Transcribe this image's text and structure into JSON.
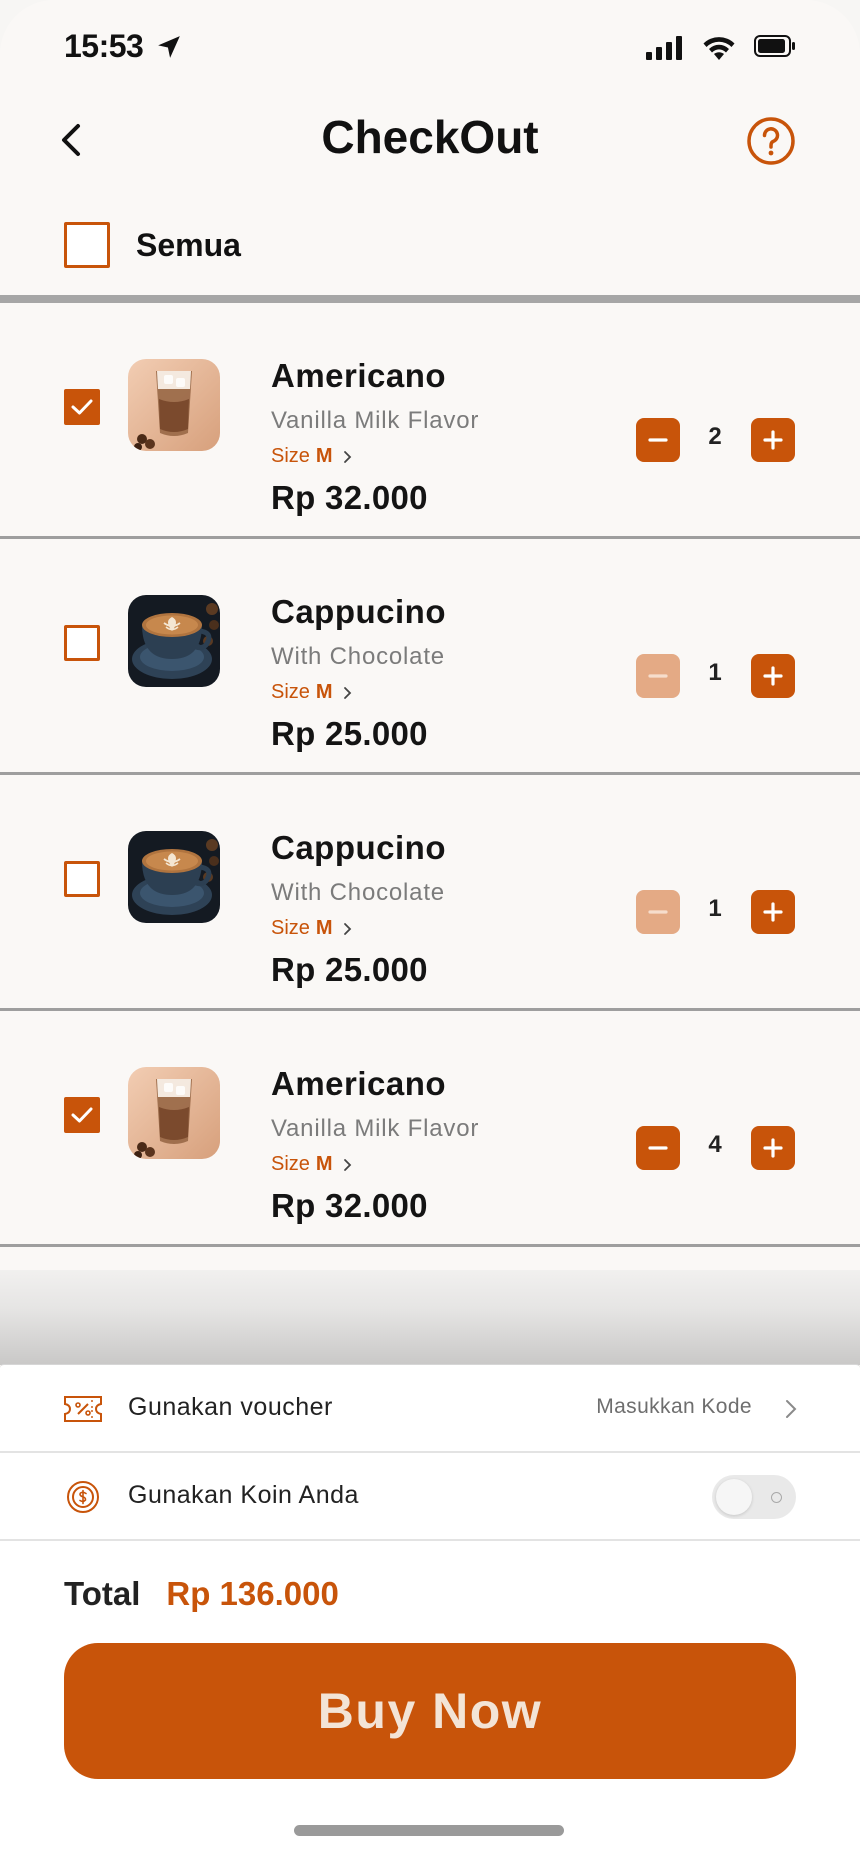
{
  "status_bar": {
    "time": "15:53"
  },
  "header": {
    "title": "CheckOut"
  },
  "select_all": {
    "label": "Semua",
    "checked": false
  },
  "items": [
    {
      "name": "Americano",
      "flavor": "Vanilla Milk Flavor",
      "size_label": "Size",
      "size": "M",
      "price": "Rp 32.000",
      "quantity": "2",
      "checked": true,
      "image": "iced-americano"
    },
    {
      "name": "Cappucino",
      "flavor": "With  Chocolate",
      "size_label": "Size",
      "size": "M",
      "price": "Rp 25.000",
      "quantity": "1",
      "checked": false,
      "image": "cappuccino-cup"
    },
    {
      "name": "Cappucino",
      "flavor": "With  Chocolate",
      "size_label": "Size",
      "size": "M",
      "price": "Rp 25.000",
      "quantity": "1",
      "checked": false,
      "image": "cappuccino-cup"
    },
    {
      "name": "Americano",
      "flavor": "Vanilla Milk Flavor",
      "size_label": "Size",
      "size": "M",
      "price": "Rp 32.000",
      "quantity": "4",
      "checked": true,
      "image": "iced-americano"
    }
  ],
  "voucher": {
    "label": "Gunakan voucher",
    "hint": "Masukkan Kode"
  },
  "coin": {
    "label": "Gunakan Koin Anda",
    "enabled": false
  },
  "total": {
    "label": "Total",
    "value": "Rp 136.000"
  },
  "buy_button": {
    "label": "Buy Now"
  },
  "colors": {
    "accent": "#c8540a",
    "accent_disabled": "#e4aa85",
    "background": "#faf8f6"
  }
}
